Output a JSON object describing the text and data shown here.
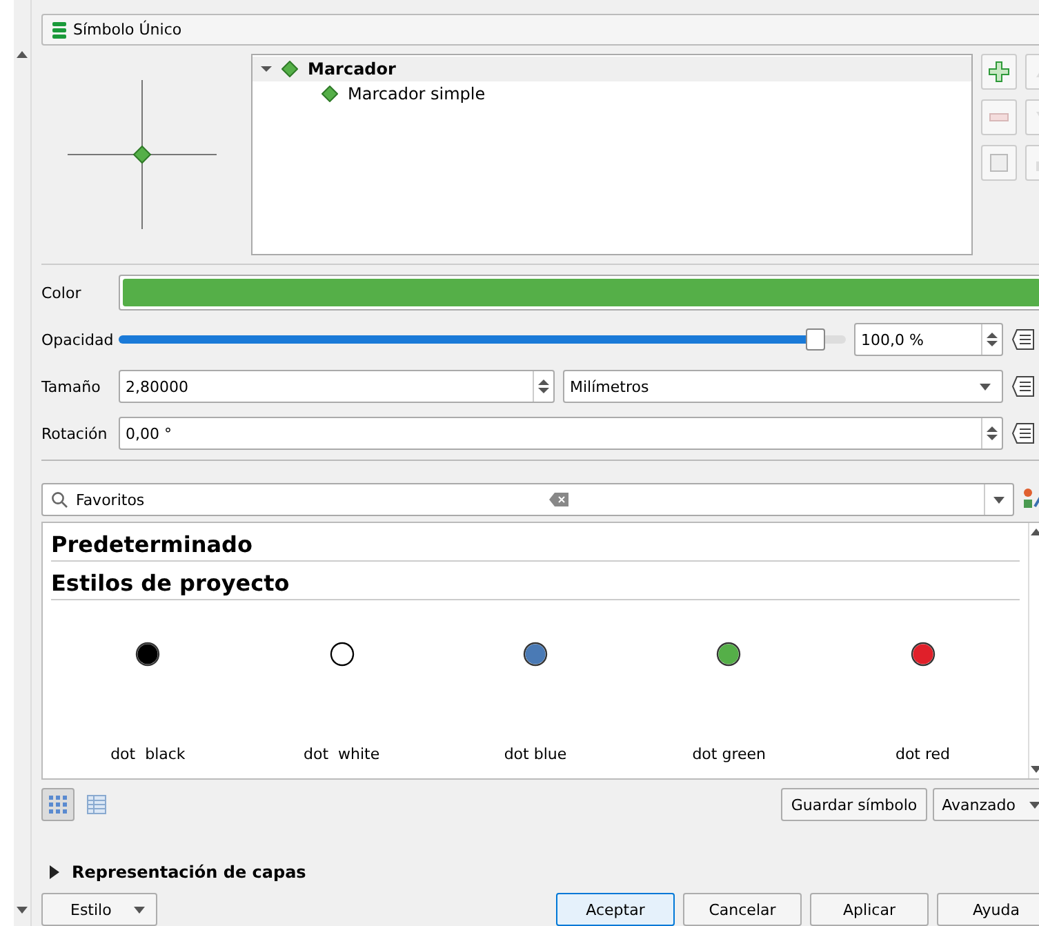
{
  "renderer": {
    "label": "Símbolo Único"
  },
  "symbol_tree": [
    {
      "label": "Marcador",
      "expanded": true,
      "children": [
        {
          "label": "Marcador simple"
        }
      ]
    }
  ],
  "color": {
    "label": "Color",
    "color": "#55af48"
  },
  "opacity": {
    "label": "Opacidad",
    "level": 0.97,
    "value": "100,0 %"
  },
  "size": {
    "label": "Tamaño",
    "value": "2,80000",
    "unit": "Milímetros"
  },
  "rotation": {
    "label": "Rotación",
    "value": "0,00 °"
  },
  "search": {
    "value": "Favoritos"
  },
  "library": {
    "groups": [
      "Predeterminado",
      "Estilos de proyecto"
    ],
    "symbols": [
      {
        "name": "dot  black",
        "color": "#000000"
      },
      {
        "name": "dot  white",
        "color": "#ffffff"
      },
      {
        "name": "dot blue",
        "color": "#4a7ab5"
      },
      {
        "name": "dot green",
        "color": "#55af48"
      },
      {
        "name": "dot red",
        "color": "#e0202a"
      }
    ]
  },
  "view_modes": [
    {
      "kind": "icons",
      "selected": true
    },
    {
      "kind": "list",
      "selected": false
    }
  ],
  "save_button": "Guardar símbolo",
  "advanced_button": "Avanzado",
  "layer_rendering": {
    "label": "Representación de capas",
    "expanded": false
  },
  "style_button": "Estilo",
  "buttons": [
    "Aceptar",
    "Cancelar",
    "Aplicar",
    "Ayuda"
  ]
}
